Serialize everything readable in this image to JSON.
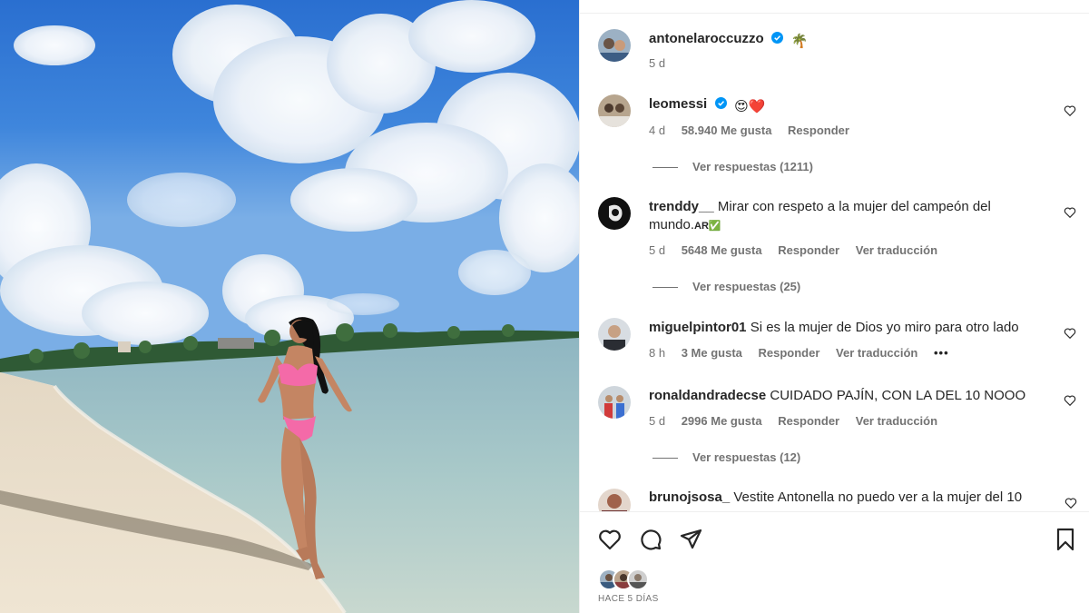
{
  "post": {
    "author": "antonelaroccuzzo",
    "author_emoji": "🌴",
    "time": "5 d",
    "time_ago": "HACE 5 DÍAS"
  },
  "comments": [
    {
      "username": "leomessi",
      "verified": true,
      "text": "",
      "emoji": "😍❤️",
      "time": "4 d",
      "likes": "58.940 Me gusta",
      "reply": "Responder",
      "view_replies": "Ver respuestas (1211)"
    },
    {
      "username": "trenddy__",
      "text_line1": "Mirar con respeto a la mujer del campeón del",
      "text_line2": "mundo.",
      "text_suffix": "AR✅",
      "time": "5 d",
      "likes": "5648 Me gusta",
      "reply": "Responder",
      "translate": "Ver traducción",
      "view_replies": "Ver respuestas (25)"
    },
    {
      "username": "miguelpintor01",
      "text": "Si es la mujer de Dios yo miro para otro lado",
      "time": "8 h",
      "likes": "3 Me gusta",
      "reply": "Responder",
      "translate": "Ver traducción",
      "more": "•••"
    },
    {
      "username": "ronaldandradecse",
      "text": "CUIDADO PAJÍN, CON LA DEL 10 NOOO",
      "time": "5 d",
      "likes": "2996 Me gusta",
      "reply": "Responder",
      "translate": "Ver traducción",
      "view_replies": "Ver respuestas (12)"
    },
    {
      "username": "brunojsosa_",
      "text": "Vestite Antonella no puedo ver a la mujer del 10"
    }
  ],
  "icons": {
    "like": "heart-icon",
    "comment": "comment-bubble-icon",
    "share": "paper-plane-icon",
    "save": "bookmark-icon",
    "verified": "verified-badge-icon"
  },
  "colors": {
    "verified_blue": "#0095f6",
    "text": "#262626",
    "muted": "#737373",
    "pink": "#f46aa8"
  }
}
